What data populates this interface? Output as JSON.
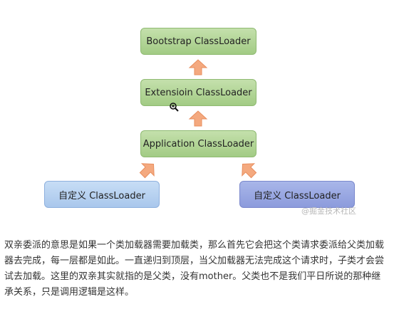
{
  "diagram": {
    "nodes": [
      {
        "id": "bootstrap",
        "label": "Bootstrap ClassLoader",
        "color": "#a8cf8a"
      },
      {
        "id": "extension",
        "label": "Extensioin ClassLoader",
        "color": "#a8cf8a"
      },
      {
        "id": "application",
        "label": "Application ClassLoader",
        "color": "#a8cf8a"
      },
      {
        "id": "custom1",
        "label": "自定义 ClassLoader",
        "color": "#b3cff0"
      },
      {
        "id": "custom2",
        "label": "自定义 ClassLoader",
        "color": "#94a3e0"
      }
    ],
    "edges": [
      {
        "from": "extension",
        "to": "bootstrap"
      },
      {
        "from": "application",
        "to": "extension"
      },
      {
        "from": "custom1",
        "to": "application"
      },
      {
        "from": "custom2",
        "to": "application"
      }
    ],
    "arrow_color": "#f4a97f",
    "watermark": "@掘金技术社区"
  },
  "text": {
    "paragraph": "双亲委派的意思是如果一个类加载器需要加载类，那么首先它会把这个类请求委派给父类加载器去完成，每一层都是如此。一直递归到顶层，当父加载器无法完成这个请求时，子类才会尝试去加载。这里的双亲其实就指的是父类，没有mother。父类也不是我们平日所说的那种继承关系，只是调用逻辑是这样。"
  },
  "icons": {
    "cursor": "zoom-cursor-icon"
  }
}
